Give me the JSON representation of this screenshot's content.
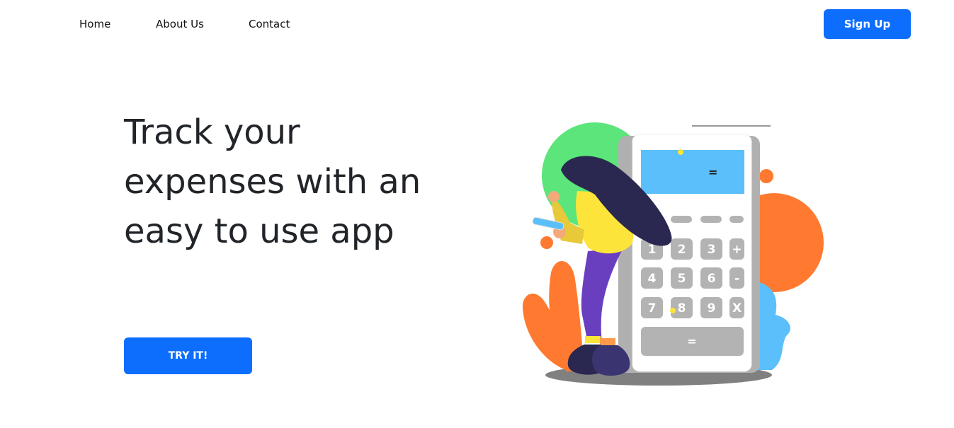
{
  "nav": {
    "home": "Home",
    "about": "About Us",
    "contact": "Contact",
    "signup": "Sign Up"
  },
  "hero": {
    "headline": "Track your expenses with an easy to use app",
    "cta": "TRY IT!"
  },
  "illustration": {
    "display": "=",
    "keys": [
      "1",
      "2",
      "3",
      "+",
      "4",
      "5",
      "6",
      "-",
      "7",
      "8",
      "9",
      "X"
    ],
    "equals": "="
  },
  "colors": {
    "accent": "#0d6efd",
    "green": "#5ce57a",
    "orange": "#ff7a30",
    "sky": "#5bbffb",
    "key_grey": "#b3b3b3",
    "person_dark": "#2a2850",
    "person_purple": "#6a3fbf",
    "person_yellow": "#fde43a"
  }
}
